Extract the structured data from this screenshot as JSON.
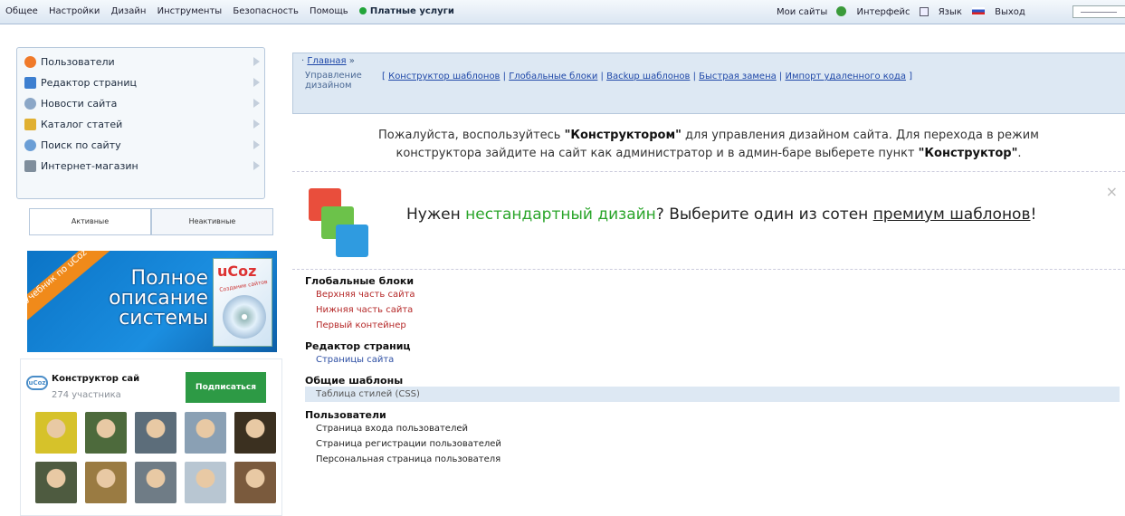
{
  "topbar": {
    "menu": [
      "Общее",
      "Настройки",
      "Дизайн",
      "Инструменты",
      "Безопасность",
      "Помощь"
    ],
    "paid": "Платные услуги",
    "my_sites": "Мои сайты",
    "interface": "Интерфейс",
    "language": "Язык",
    "logout": "Выход"
  },
  "sidebar": {
    "items": [
      {
        "label": "Пользователи",
        "icon": "user-icon",
        "color": "#f07a2a"
      },
      {
        "label": "Редактор страниц",
        "icon": "page-editor-icon",
        "color": "#3d7fd0"
      },
      {
        "label": "Новости сайта",
        "icon": "news-icon",
        "color": "#8ba7c7"
      },
      {
        "label": "Каталог статей",
        "icon": "catalog-icon",
        "color": "#e0b032"
      },
      {
        "label": "Поиск по сайту",
        "icon": "search-icon",
        "color": "#6a9ed6"
      },
      {
        "label": "Интернет-магазин",
        "icon": "shop-icon",
        "color": "#7f8e9c"
      }
    ],
    "tab_active": "Активные",
    "tab_inactive": "Неактивные"
  },
  "promo": {
    "ribbon": "Учебник по uCoz",
    "line1": "Полное",
    "line2": "описание",
    "line3": "системы",
    "logo": "uCoz",
    "sub": "Создание сайтов"
  },
  "group": {
    "logo": "uCoz",
    "name": "Конструктор сай",
    "count": "274 участника",
    "subscribe": "Подписаться"
  },
  "main": {
    "crumb_home": "Главная",
    "crumb_sep": "»",
    "section": "Управление дизайном",
    "links": [
      "Конструктор шаблонов",
      "Глобальные блоки",
      "Backup шаблонов",
      "Быстрая замена",
      "Импорт удаленного кода"
    ],
    "info_pre": "Пожалуйста, воспользуйтесь ",
    "info_b1": "\"Конструктором\"",
    "info_mid": " для управления дизайном сайта. Для перехода в режим",
    "info_line2_pre": "конструктора зайдите на сайт как администратор и в админ-баре выберете пункт ",
    "info_b2": "\"Конструктор\"",
    "info_end": ".",
    "banner_pre": "Нужен ",
    "banner_green": "нестандартный дизайн",
    "banner_mid": "? Выберите один из сотен ",
    "banner_link": "премиум шаблонов",
    "banner_end": "!",
    "close": "×"
  },
  "tree": [
    {
      "head": "Глобальные блоки",
      "items": [
        {
          "label": "Верхняя часть сайта",
          "style": "red"
        },
        {
          "label": "Нижняя часть сайта",
          "style": "red"
        },
        {
          "label": "Первый контейнер",
          "style": "red"
        }
      ]
    },
    {
      "head": "Редактор страниц",
      "items": [
        {
          "label": "Страницы сайта",
          "style": "blue"
        }
      ]
    },
    {
      "head": "Общие шаблоны",
      "items": [
        {
          "label": "Таблица стилей (CSS)",
          "style": "sel"
        }
      ]
    },
    {
      "head": "Пользователи",
      "items": [
        {
          "label": "Страница входа пользователей",
          "style": "dark"
        },
        {
          "label": "Страница регистрации пользователей",
          "style": "dark"
        },
        {
          "label": "Персональная страница пользователя",
          "style": "dark"
        }
      ]
    }
  ],
  "avatars": [
    "#d6c22a",
    "#4d6a3c",
    "#5c6d7a",
    "#8aa0b4",
    "#3b3020",
    "#4e5b40",
    "#9a7b42",
    "#6f7c86",
    "#b8c6d2",
    "#7a5a3d"
  ]
}
